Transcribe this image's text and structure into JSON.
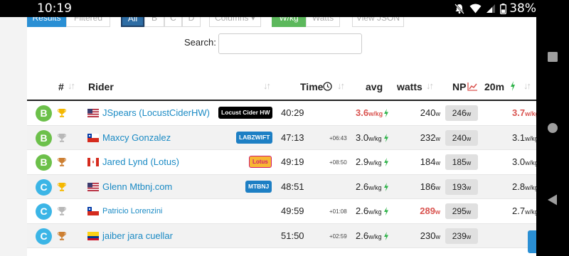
{
  "status_bar": {
    "time": "10:19",
    "battery": "38%"
  },
  "toolbar": {
    "buttons": [
      "Results",
      "Filtered",
      "All",
      "B",
      "C",
      "D",
      "Columns ▾",
      "W/kg",
      "Watts",
      "View JSON"
    ]
  },
  "search": {
    "label": "Search:",
    "value": ""
  },
  "table": {
    "headers": {
      "pos": "#",
      "rider": "Rider",
      "time": "Time",
      "avg": "avg",
      "watts": "watts",
      "np": "NP",
      "w20m": "20m"
    },
    "rows": [
      {
        "cat": "B",
        "cat_color": "#6cc04a",
        "trophy": "gold",
        "flag": "us",
        "rider": "JSpears (LocustCiderHW)",
        "team": "Locust Cider HW",
        "team_bg": "#000000",
        "team_fg": "#ffffff",
        "time": "40:29",
        "gap": "",
        "avg": "3.6",
        "avg_unit": "w/kg",
        "avg_red": true,
        "watts": "240",
        "watts_unit": "w",
        "watts_red": false,
        "np": "246",
        "np_unit": "w",
        "w20m": "3.7",
        "w20m_unit": "w/kg",
        "w20m_red": true
      },
      {
        "cat": "B",
        "cat_color": "#6cc04a",
        "trophy": "silver",
        "flag": "cl",
        "rider": "Maxcy Gonzalez",
        "team": "LABZWIFT",
        "team_bg": "#1d7fc4",
        "team_fg": "#ffffff",
        "time": "47:13",
        "gap": "+06:43",
        "avg": "3.0",
        "avg_unit": "w/kg",
        "avg_red": false,
        "watts": "232",
        "watts_unit": "w",
        "watts_red": false,
        "np": "240",
        "np_unit": "w",
        "w20m": "3.1",
        "w20m_unit": "w/kg",
        "w20m_red": false
      },
      {
        "cat": "B",
        "cat_color": "#6cc04a",
        "trophy": "bronze",
        "flag": "ca",
        "rider": "Jared Lynd (Lotus)",
        "team": "Lotus",
        "team_bg": "#f7b733",
        "team_fg": "#d01b6e",
        "time": "49:19",
        "gap": "+08:50",
        "avg": "2.9",
        "avg_unit": "w/kg",
        "avg_red": false,
        "watts": "184",
        "watts_unit": "w",
        "watts_red": false,
        "np": "185",
        "np_unit": "w",
        "w20m": "3.0",
        "w20m_unit": "w/kg",
        "w20m_red": false
      },
      {
        "cat": "C",
        "cat_color": "#3bb5e6",
        "trophy": "gold",
        "flag": "us",
        "rider": "Glenn Mtbnj.com",
        "team": "MTBNJ",
        "team_bg": "#1d7fc4",
        "team_fg": "#ffffff",
        "time": "48:51",
        "gap": "",
        "avg": "2.6",
        "avg_unit": "w/kg",
        "avg_red": false,
        "watts": "186",
        "watts_unit": "w",
        "watts_red": false,
        "np": "193",
        "np_unit": "w",
        "w20m": "2.8",
        "w20m_unit": "w/kg",
        "w20m_red": false
      },
      {
        "cat": "C",
        "cat_color": "#3bb5e6",
        "trophy": "silver",
        "flag": "cl",
        "rider": "Patricio Lorenzini",
        "team": "",
        "team_bg": "",
        "team_fg": "",
        "time": "49:59",
        "gap": "+01:08",
        "avg": "2.6",
        "avg_unit": "w/kg",
        "avg_red": false,
        "watts": "289",
        "watts_unit": "w",
        "watts_red": true,
        "np": "295",
        "np_unit": "w",
        "w20m": "2.7",
        "w20m_unit": "w/kg",
        "w20m_red": false
      },
      {
        "cat": "C",
        "cat_color": "#3bb5e6",
        "trophy": "bronze",
        "flag": "co",
        "rider": "jaiber jara cuellar",
        "team": "",
        "team_bg": "",
        "team_fg": "",
        "time": "51:50",
        "gap": "+02:59",
        "avg": "2.6",
        "avg_unit": "w/kg",
        "avg_red": false,
        "watts": "230",
        "watts_unit": "w",
        "watts_red": false,
        "np": "239",
        "np_unit": "w",
        "w20m": "",
        "w20m_unit": "",
        "w20m_red": false
      }
    ]
  },
  "colors": {
    "link": "#1a8ac4",
    "highlight_red": "#d9534f",
    "primary": "#2a8fd4",
    "bolt_green": "#2fb34a"
  }
}
